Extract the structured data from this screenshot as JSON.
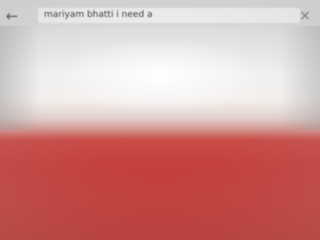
{
  "search": {
    "value": "mariyam bhatti i need a"
  },
  "icons": {
    "back": "back-arrow-icon",
    "clear": "close-icon"
  },
  "colors": {
    "toolbar": "#d6d6d6",
    "background_top": "#f2f2f2",
    "background_bottom": "#c1403c"
  }
}
